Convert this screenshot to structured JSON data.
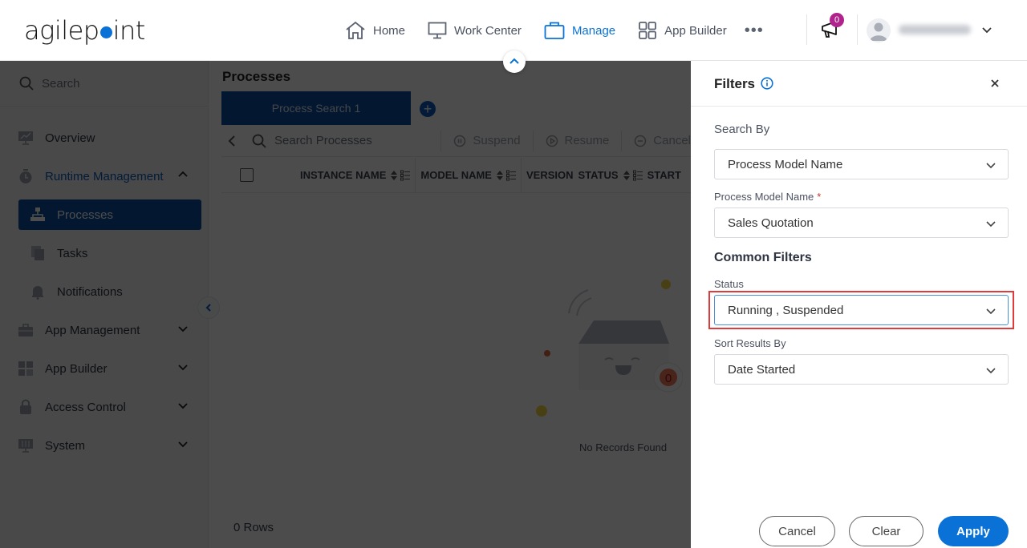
{
  "header": {
    "logo_text_left": "agilep",
    "logo_text_right": "int",
    "nav": [
      {
        "label": "Home",
        "icon": "home-icon",
        "active": false
      },
      {
        "label": "Work Center",
        "icon": "monitor-icon",
        "active": false
      },
      {
        "label": "Manage",
        "icon": "briefcase-icon",
        "active": true
      },
      {
        "label": "App Builder",
        "icon": "grid-icon",
        "active": false
      }
    ],
    "more_label": "•••",
    "notification_count": "0",
    "accent_color": "#0a72d6"
  },
  "sidebar": {
    "search_placeholder": "Search",
    "items": [
      {
        "label": "Overview",
        "icon": "chart-monitor-icon"
      },
      {
        "label": "Runtime Management",
        "icon": "stopwatch-icon",
        "expanded": true
      },
      {
        "label": "App Management",
        "icon": "toolbox-icon"
      },
      {
        "label": "App Builder",
        "icon": "app-grid-icon"
      },
      {
        "label": "Access Control",
        "icon": "lock-icon"
      },
      {
        "label": "System",
        "icon": "settings-monitor-icon"
      }
    ],
    "sub_items": [
      {
        "label": "Processes",
        "icon": "hierarchy-icon",
        "active": true
      },
      {
        "label": "Tasks",
        "icon": "tasks-icon"
      },
      {
        "label": "Notifications",
        "icon": "bell-icon"
      }
    ]
  },
  "main": {
    "title": "Processes",
    "tab_label": "Process Search 1",
    "add_tab": "+",
    "search_placeholder": "Search Processes",
    "actions": [
      "Suspend",
      "Resume",
      "Cancel"
    ],
    "columns": [
      "INSTANCE NAME",
      "MODEL NAME",
      "VERSION",
      "STATUS",
      "START"
    ],
    "empty_message": "No Records Found",
    "empty_badge": "0",
    "rows_label": "0 Rows"
  },
  "filters": {
    "title": "Filters",
    "search_by_label": "Search By",
    "search_by_value": "Process Model Name",
    "model_name_label": "Process Model Name",
    "required_mark": "*",
    "model_name_value": "Sales Quotation",
    "common_filters_label": "Common Filters",
    "status_label": "Status",
    "status_value": "Running , Suspended",
    "sort_label": "Sort Results By",
    "sort_value": "Date Started",
    "cancel_label": "Cancel",
    "clear_label": "Clear",
    "apply_label": "Apply"
  }
}
